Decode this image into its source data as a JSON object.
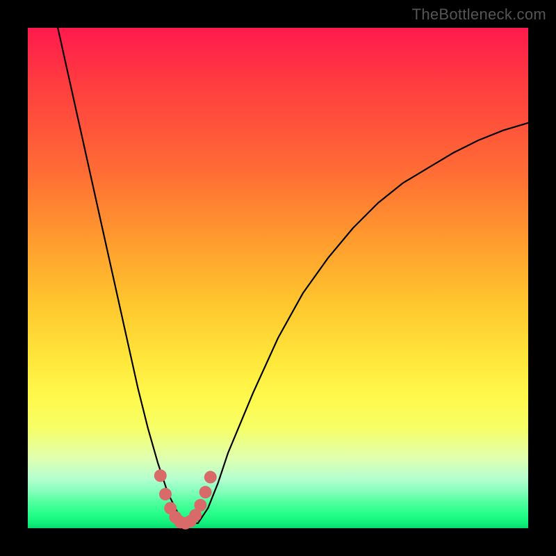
{
  "watermark": "TheBottleneck.com",
  "colors": {
    "background": "#000000",
    "curve": "#000000",
    "marker": "#d86a6a",
    "watermark": "#555555"
  },
  "chart_data": {
    "type": "line",
    "title": "",
    "xlabel": "",
    "ylabel": "",
    "xlim": [
      0,
      100
    ],
    "ylim": [
      0,
      100
    ],
    "grid": false,
    "legend": false,
    "series": [
      {
        "name": "bottleneck-curve",
        "x": [
          6,
          8,
          10,
          12,
          14,
          16,
          18,
          20,
          22,
          24,
          26,
          28,
          30,
          32,
          34,
          36,
          38,
          40,
          45,
          50,
          55,
          60,
          65,
          70,
          75,
          80,
          85,
          90,
          95,
          100
        ],
        "y": [
          100,
          91,
          82,
          73,
          64,
          55,
          46,
          37,
          28,
          20,
          13,
          7,
          3,
          1,
          1,
          4,
          9,
          15,
          27,
          38,
          47,
          54,
          60,
          65,
          69,
          72,
          75,
          77.5,
          79.5,
          81
        ]
      }
    ],
    "highlight": {
      "name": "optimal-range-markers",
      "x": [
        26.5,
        27.5,
        28.5,
        29.5,
        30.5,
        31.5,
        32.5,
        33.5,
        34.5,
        35.5,
        36.5
      ],
      "y": [
        10.5,
        6.8,
        4.0,
        2.2,
        1.2,
        1.0,
        1.4,
        2.6,
        4.6,
        7.2,
        10.2
      ]
    }
  }
}
